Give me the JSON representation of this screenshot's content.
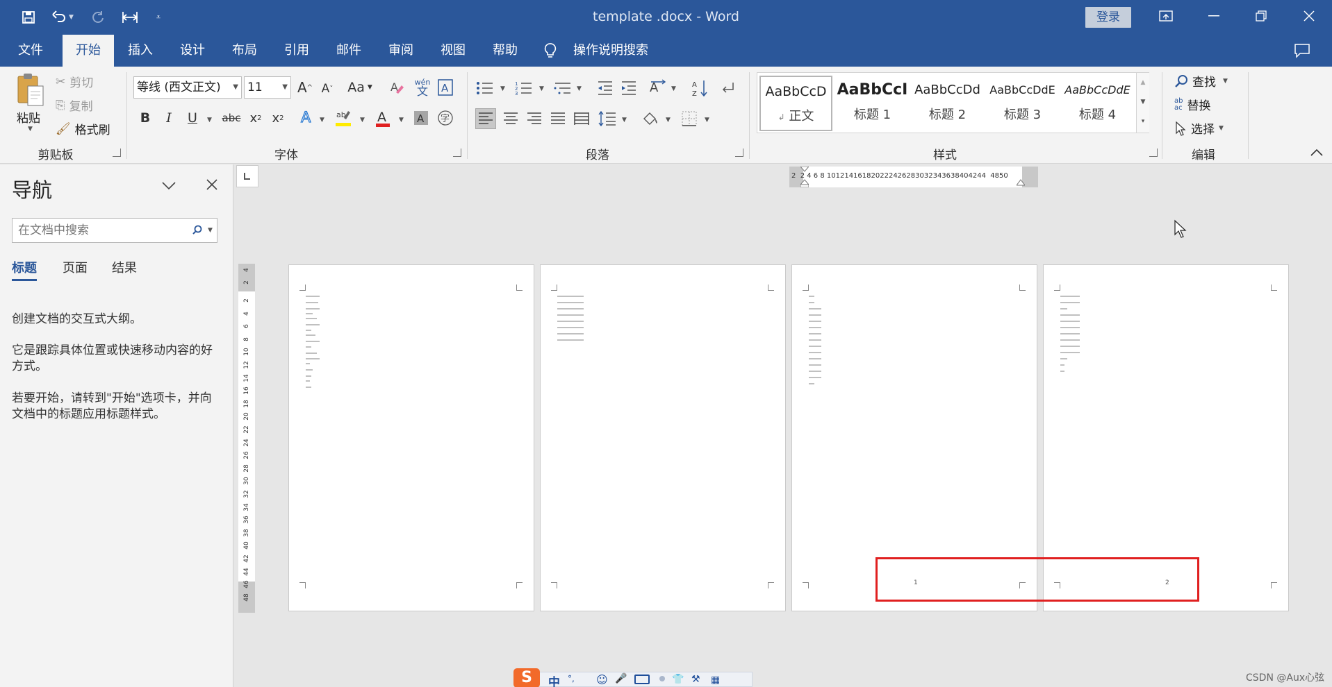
{
  "window": {
    "title": "template .docx  -  Word",
    "login_label": "登录"
  },
  "menu": {
    "tabs": [
      {
        "label": "文件"
      },
      {
        "label": "开始",
        "active": true
      },
      {
        "label": "插入"
      },
      {
        "label": "设计"
      },
      {
        "label": "布局"
      },
      {
        "label": "引用"
      },
      {
        "label": "邮件"
      },
      {
        "label": "审阅"
      },
      {
        "label": "视图"
      },
      {
        "label": "帮助"
      }
    ],
    "tell_me": "操作说明搜索"
  },
  "ribbon": {
    "clipboard": {
      "label": "剪贴板",
      "paste": "粘贴",
      "cut": "剪切",
      "copy": "复制",
      "format_painter": "格式刷"
    },
    "font": {
      "label": "字体",
      "font_name": "等线 (西文正文)",
      "font_size": "11",
      "change_case": "Aa",
      "phonetic_top": "wén",
      "phonetic_bottom": "文",
      "bold": "B",
      "italic": "I",
      "underline": "U",
      "strikethrough": "abc",
      "subscript": "x",
      "subscript_mark": "2",
      "superscript": "x",
      "superscript_mark": "2",
      "font_color_letter": "A",
      "enclose_char": "字"
    },
    "paragraph": {
      "label": "段落"
    },
    "styles": {
      "label": "样式",
      "items": [
        {
          "preview": "AaBbCcD",
          "name": "正文",
          "selected": true
        },
        {
          "preview": "AaBbCcI",
          "name": "标题 1"
        },
        {
          "preview": "AaBbCcDd",
          "name": "标题 2"
        },
        {
          "preview": "AaBbCcDdE",
          "name": "标题 3"
        },
        {
          "preview": "AaBbCcDdE",
          "name": "标题 4"
        }
      ]
    },
    "editing": {
      "label": "编辑",
      "find": "查找",
      "replace": "替换",
      "replace_icon_top": "ab",
      "replace_icon_bottom": "ac",
      "select": "选择"
    }
  },
  "navigation": {
    "title": "导航",
    "search_placeholder": "在文档中搜索",
    "tabs": [
      {
        "label": "标题",
        "active": true
      },
      {
        "label": "页面"
      },
      {
        "label": "结果"
      }
    ],
    "hint1": "创建文档的交互式大纲。",
    "hint2": "它是跟踪具体位置或快速移动内容的好方式。",
    "hint3": "若要开始，请转到\"开始\"选项卡，并向文档中的标题应用标题样式。"
  },
  "rulers": {
    "horizontal": "2  2 4 6 8 101214161820222426283032343638404244  4850",
    "vertical": [
      "4",
      "2",
      "2",
      "4",
      "6",
      "8",
      "10",
      "12",
      "14",
      "16",
      "18",
      "20",
      "22",
      "24",
      "26",
      "28",
      "30",
      "32",
      "34",
      "36",
      "38",
      "40",
      "42",
      "44",
      "46",
      "48"
    ]
  },
  "pages": [
    {
      "footer": ""
    },
    {
      "footer": ""
    },
    {
      "footer": "1"
    },
    {
      "footer": "2"
    }
  ],
  "taskbar": {
    "ime_mode": "中"
  },
  "watermark": "CSDN @Aux心弦",
  "colors": {
    "brand": "#2b579a",
    "highlight": "#e02020"
  }
}
